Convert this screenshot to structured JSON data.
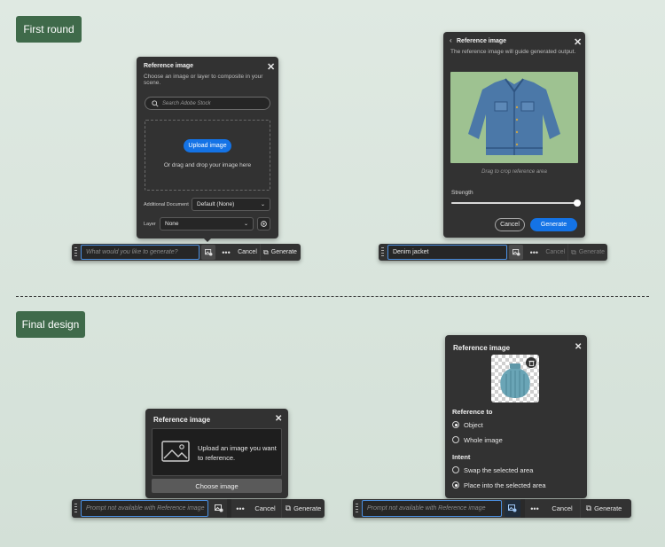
{
  "sections": {
    "first_round": "First round",
    "final_design": "Final design"
  },
  "fr_left": {
    "panel": {
      "title": "Reference image",
      "subtitle": "Choose an image or layer to composite in your scene.",
      "search_placeholder": "Search Adobe Stock",
      "upload_label": "Upload image",
      "drop_hint": "Or drag and drop your image here",
      "additional_doc_label": "Additional Document",
      "additional_doc_value": "Default (None)",
      "layer_label": "Layer",
      "layer_value": "None"
    },
    "bar": {
      "prompt_placeholder": "What would you like to generate?",
      "cancel": "Cancel",
      "generate": "Generate"
    }
  },
  "fr_right": {
    "panel": {
      "title": "Reference image",
      "subtitle": "The reference image will guide generated output.",
      "crop_hint": "Drag to crop reference area",
      "strength_label": "Strength",
      "strength_value": 1.0,
      "cancel": "Cancel",
      "generate": "Generate"
    },
    "bar": {
      "prompt_value": "Denim jacket",
      "cancel": "Cancel",
      "generate": "Generate"
    }
  },
  "fd_left": {
    "panel": {
      "title": "Reference image",
      "drop_text": "Upload an image you want to reference.",
      "choose_label": "Choose image"
    },
    "bar": {
      "prompt_placeholder": "Prompt not available with Reference image",
      "cancel": "Cancel",
      "generate": "Generate"
    }
  },
  "fd_right": {
    "panel": {
      "title": "Reference image",
      "reference_to_label": "Reference to",
      "opt_object": "Object",
      "opt_whole": "Whole image",
      "intent_label": "Intent",
      "opt_swap": "Swap the selected area",
      "opt_place": "Place into the selected area"
    },
    "bar": {
      "prompt_placeholder": "Prompt not available with Reference image",
      "cancel": "Cancel",
      "generate": "Generate"
    }
  },
  "icons": {
    "close": "close-icon",
    "search": "search-icon",
    "back": "chevron-left-icon",
    "more": "more-icon",
    "generate": "generate-icon",
    "reference": "reference-image-icon",
    "trash": "trash-icon",
    "image_placeholder": "image-placeholder-icon",
    "settings": "settings-icon",
    "chevron_down": "chevron-down-icon"
  },
  "colors": {
    "tag_bg": "#3f6a4a",
    "panel_bg": "#323232",
    "accent_blue": "#1473e6"
  }
}
